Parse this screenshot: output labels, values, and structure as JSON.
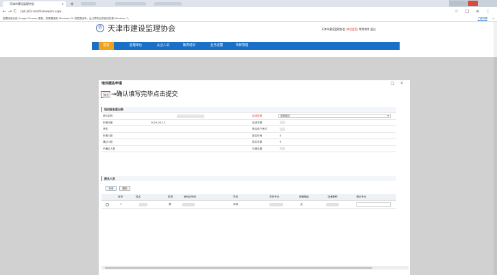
{
  "browser": {
    "tab_title": "天津市建设监理协会",
    "tab_close": "×",
    "new_tab": "+",
    "url": "tjxh.jl03.com/framework.aspx",
    "info_text": "若要接收后续 Google Chrome 更新，您需要使用 Windows 10 或更高版本。此计算机目前使用的是 Windows 7。",
    "info_link": "了解详情",
    "info_close": "×",
    "nav_back": "←",
    "nav_forward": "→",
    "nav_reload": "C",
    "addr_right_icons": "☆ □ ≡ ⋮"
  },
  "site": {
    "logo": "协",
    "title": "天津市建设监理协会",
    "user_org": "天津市建设监理协会",
    "user_role": "(单位会员)",
    "user_links": "常用软件  退出"
  },
  "nav": [
    "首页",
    "监理单位",
    "从业人员",
    "教育培训",
    "业务设置",
    "项目管理"
  ],
  "dialog": {
    "title": "培训报名申请",
    "controls": "□ ×",
    "submit_button": "提交",
    "annotation": "→确认填写完毕点击提交",
    "section_info": "培训报名登记表",
    "section_people": "报名人员"
  },
  "info_rows": [
    {
      "left_label": "单位名称",
      "left_value": "",
      "right_label": "培训类型",
      "right_value": ""
    },
    {
      "left_label": "申请日期",
      "left_value": "2023-03-13",
      "right_label": "培训学期",
      "right_value": ""
    },
    {
      "left_label": "状态",
      "left_value": "",
      "right_label": "是否线下考试",
      "right_value": ""
    },
    {
      "left_label": "申请人数",
      "left_value": "",
      "right_label": "报名时间",
      "right_value": "0"
    },
    {
      "left_label": "通过人数",
      "left_value": "",
      "right_label": "报名总额",
      "right_value": "0"
    },
    {
      "left_label": "不通过人数",
      "left_value": "",
      "right_label": "已缴总额",
      "right_value": ""
    }
  ],
  "training_select": "选择培训",
  "people_buttons": [
    "新增",
    "删除"
  ],
  "people_table": {
    "headers": [
      "序号",
      "姓名",
      "性别",
      "身份证号码",
      "学历",
      "学历专业",
      "资格等级",
      "技术职称",
      "登记专业"
    ],
    "rows": [
      {
        "seq": "1",
        "name": "",
        "gender": "男",
        "id_number": "",
        "education": "本科",
        "major": "",
        "qualification": "无",
        "title": "",
        "reg_major": ""
      }
    ]
  }
}
